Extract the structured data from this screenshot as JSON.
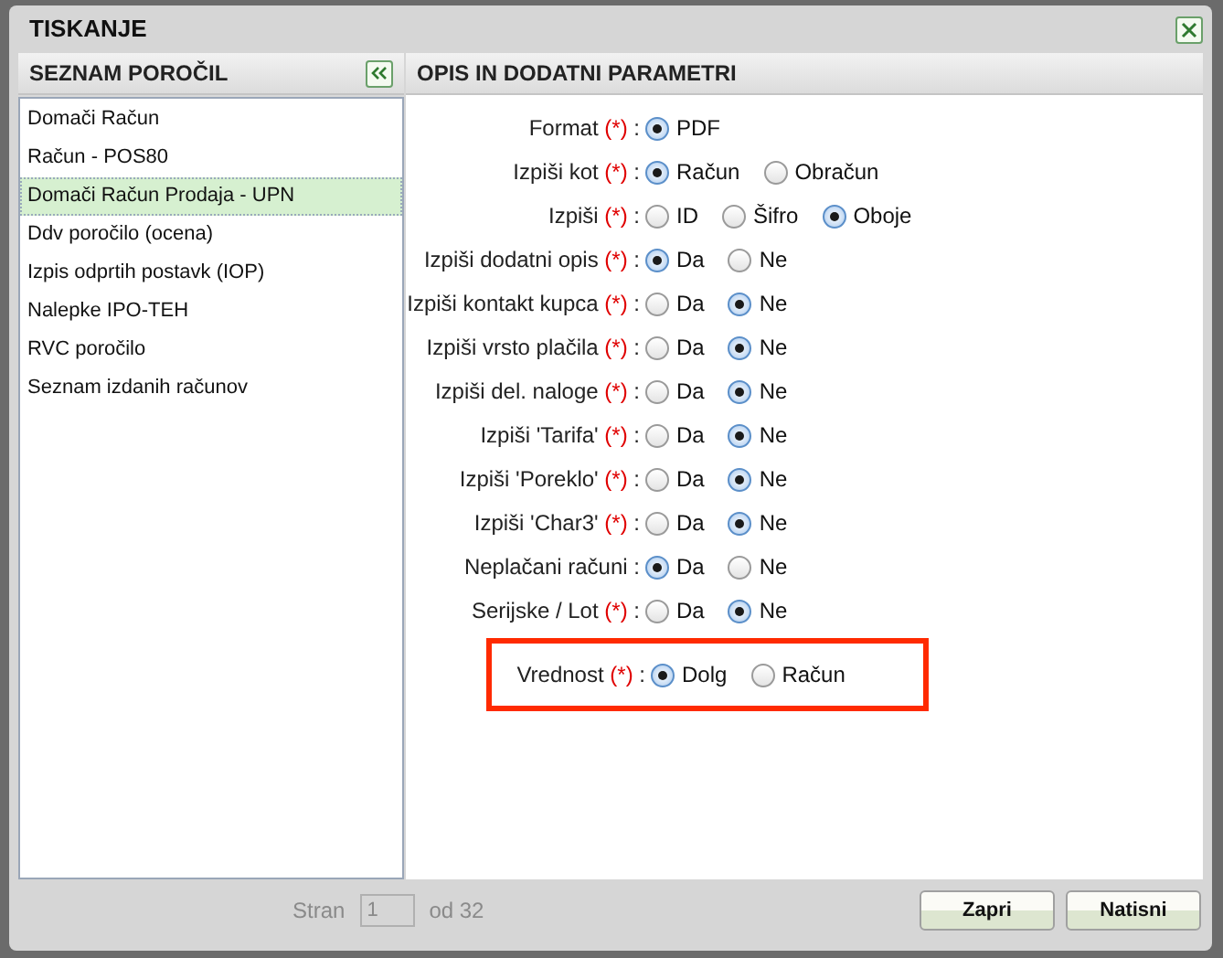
{
  "dialog": {
    "title": "TISKANJE"
  },
  "reports": {
    "title": "SEZNAM POROČIL",
    "items": [
      {
        "label": "Domači Račun",
        "selected": false
      },
      {
        "label": "Račun - POS80",
        "selected": false
      },
      {
        "label": "Domači Račun Prodaja - UPN",
        "selected": true
      },
      {
        "label": "Ddv poročilo (ocena)",
        "selected": false
      },
      {
        "label": "Izpis odprtih postavk (IOP)",
        "selected": false
      },
      {
        "label": "Nalepke IPO-TEH",
        "selected": false
      },
      {
        "label": "RVC poročilo",
        "selected": false
      },
      {
        "label": "Seznam izdanih računov",
        "selected": false
      }
    ]
  },
  "parameters": {
    "title": "OPIS IN DODATNI PARAMETRI",
    "fields": [
      {
        "label": "Format",
        "required": "(*)",
        "separator": ":",
        "highlighted": false,
        "options": [
          {
            "label": "PDF",
            "selected": true
          }
        ]
      },
      {
        "label": "Izpiši kot",
        "required": "(*)",
        "separator": ":",
        "highlighted": false,
        "options": [
          {
            "label": "Račun",
            "selected": true
          },
          {
            "label": "Obračun",
            "selected": false
          }
        ]
      },
      {
        "label": "Izpiši",
        "required": "(*)",
        "separator": ":",
        "highlighted": false,
        "options": [
          {
            "label": "ID",
            "selected": false
          },
          {
            "label": "Šifro",
            "selected": false
          },
          {
            "label": "Oboje",
            "selected": true
          }
        ]
      },
      {
        "label": "Izpiši dodatni opis",
        "required": "(*)",
        "separator": ":",
        "highlighted": false,
        "options": [
          {
            "label": "Da",
            "selected": true
          },
          {
            "label": "Ne",
            "selected": false
          }
        ]
      },
      {
        "label": "Izpiši kontakt kupca",
        "required": "(*)",
        "separator": ":",
        "highlighted": false,
        "options": [
          {
            "label": "Da",
            "selected": false
          },
          {
            "label": "Ne",
            "selected": true
          }
        ]
      },
      {
        "label": "Izpiši vrsto plačila",
        "required": "(*)",
        "separator": ":",
        "highlighted": false,
        "options": [
          {
            "label": "Da",
            "selected": false
          },
          {
            "label": "Ne",
            "selected": true
          }
        ]
      },
      {
        "label": "Izpiši del. naloge",
        "required": "(*)",
        "separator": ":",
        "highlighted": false,
        "options": [
          {
            "label": "Da",
            "selected": false
          },
          {
            "label": "Ne",
            "selected": true
          }
        ]
      },
      {
        "label": "Izpiši 'Tarifa'",
        "required": "(*)",
        "separator": ":",
        "highlighted": false,
        "options": [
          {
            "label": "Da",
            "selected": false
          },
          {
            "label": "Ne",
            "selected": true
          }
        ]
      },
      {
        "label": "Izpiši 'Poreklo'",
        "required": "(*)",
        "separator": ":",
        "highlighted": false,
        "options": [
          {
            "label": "Da",
            "selected": false
          },
          {
            "label": "Ne",
            "selected": true
          }
        ]
      },
      {
        "label": "Izpiši 'Char3'",
        "required": "(*)",
        "separator": ":",
        "highlighted": false,
        "options": [
          {
            "label": "Da",
            "selected": false
          },
          {
            "label": "Ne",
            "selected": true
          }
        ]
      },
      {
        "label": "Neplačani računi",
        "separator": ":",
        "highlighted": false,
        "options": [
          {
            "label": "Da",
            "selected": true
          },
          {
            "label": "Ne",
            "selected": false
          }
        ]
      },
      {
        "label": "Serijske / Lot",
        "required": "(*)",
        "separator": ":",
        "highlighted": false,
        "options": [
          {
            "label": "Da",
            "selected": false
          },
          {
            "label": "Ne",
            "selected": true
          }
        ]
      },
      {
        "label": "Vrednost",
        "required": "(*)",
        "separator": ":",
        "highlighted": true,
        "options": [
          {
            "label": "Dolg",
            "selected": true
          },
          {
            "label": "Račun",
            "selected": false
          }
        ]
      }
    ]
  },
  "pager": {
    "label": "Stran",
    "page": "1",
    "total": "od 32"
  },
  "buttons": [
    "Zapri",
    "Natisni"
  ]
}
